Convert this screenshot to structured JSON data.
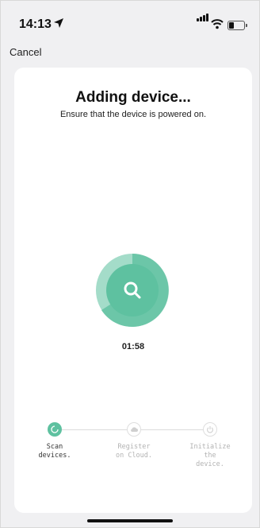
{
  "status_bar": {
    "time": "14:13",
    "location_icon": "location-arrow-icon",
    "signal_icon": "cellular-signal-icon",
    "wifi_icon": "wifi-icon",
    "battery_icon": "battery-icon",
    "battery_level": 0.3
  },
  "nav": {
    "cancel_label": "Cancel"
  },
  "main": {
    "title": "Adding device...",
    "subtitle": "Ensure that the device is powered on.",
    "scan_icon": "search-icon",
    "timer": "01:58"
  },
  "steps": [
    {
      "label_line1": "Scan",
      "label_line2": "devices.",
      "label_line3": "",
      "state": "active",
      "icon": "loading-icon"
    },
    {
      "label_line1": "Register",
      "label_line2": "on Cloud.",
      "label_line3": "",
      "state": "pending",
      "icon": "cloud-icon"
    },
    {
      "label_line1": "Initialize",
      "label_line2": "the",
      "label_line3": "device.",
      "state": "pending",
      "icon": "power-icon"
    }
  ],
  "colors": {
    "accent": "#5ec1a0",
    "accent_light": "#a4dcc9",
    "accent_mid": "#6cc6a8"
  }
}
